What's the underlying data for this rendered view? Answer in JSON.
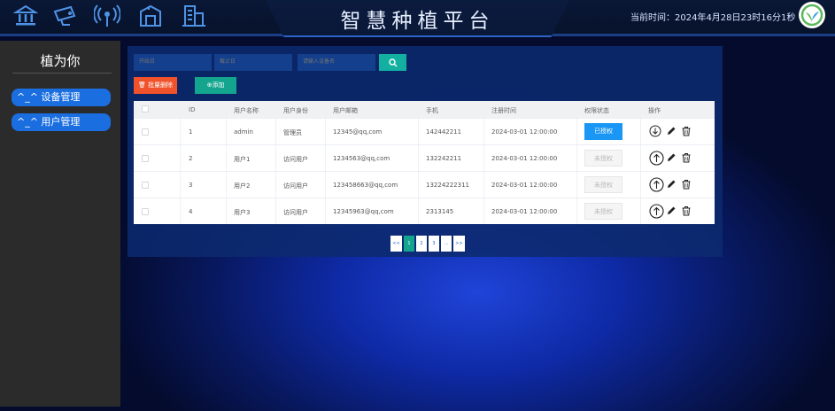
{
  "header": {
    "title": "智慧种植平台",
    "clock": "当前时间：2024年4月28日23时16分1秒",
    "nav_icons": [
      "bank-icon",
      "camera-icon",
      "signal-icon",
      "greenhouse-icon",
      "building-icon"
    ],
    "logo_icon": "plant-logo-icon"
  },
  "sidebar": {
    "title": "植为你",
    "items": [
      {
        "label": "^_^ 设备管理"
      },
      {
        "label": "^_^ 用户管理"
      }
    ]
  },
  "filters": {
    "start_placeholder": "开始日",
    "end_placeholder": "截止日",
    "device_placeholder": "请输入设备名",
    "search_icon": "search-icon"
  },
  "toolbar": {
    "batch_delete_label": "批量删除",
    "add_label": "添加"
  },
  "table": {
    "headers": [
      "ID",
      "用户名称",
      "用户身份",
      "用户邮箱",
      "手机",
      "注册时间",
      "权限状态",
      "操作"
    ],
    "rows": [
      {
        "id": "1",
        "name": "admin",
        "role": "管理员",
        "email": "12345@qq,com",
        "phone": "142442211",
        "registered": "2024-03-01 12:00:00",
        "auth": "已授权",
        "authorized": true
      },
      {
        "id": "2",
        "name": "用户1",
        "role": "访问用户",
        "email": "1234563@qq,com",
        "phone": "132242211",
        "registered": "2024-03-01 12:00:00",
        "auth": "未授权",
        "authorized": false
      },
      {
        "id": "3",
        "name": "用户2",
        "role": "访问用户",
        "email": "123458663@qq,com",
        "phone": "13224222311",
        "registered": "2024-03-01 12:00:00",
        "auth": "未授权",
        "authorized": false
      },
      {
        "id": "4",
        "name": "用户3",
        "role": "访问用户",
        "email": "12345963@qq,com",
        "phone": "2313145",
        "registered": "2024-03-01 12:00:00",
        "auth": "未授权",
        "authorized": false
      }
    ]
  },
  "pagination": {
    "first": "<<",
    "pages": [
      "1",
      "2",
      "3"
    ],
    "ellipsis": "...",
    "last": ">>",
    "current": "1"
  },
  "colors": {
    "accent": "#1a6ee0",
    "delete": "#f0522b",
    "add": "#13a58e",
    "authorized": "#1a97f5"
  }
}
